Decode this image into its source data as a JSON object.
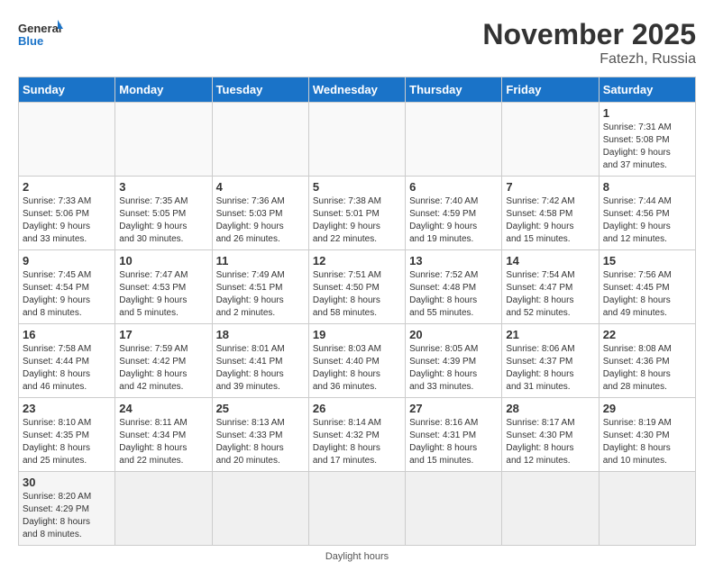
{
  "logo": {
    "general": "General",
    "blue": "Blue"
  },
  "title": "November 2025",
  "subtitle": "Fatezh, Russia",
  "days_of_week": [
    "Sunday",
    "Monday",
    "Tuesday",
    "Wednesday",
    "Thursday",
    "Friday",
    "Saturday"
  ],
  "footer": "Daylight hours",
  "weeks": [
    [
      {
        "day": "",
        "info": ""
      },
      {
        "day": "",
        "info": ""
      },
      {
        "day": "",
        "info": ""
      },
      {
        "day": "",
        "info": ""
      },
      {
        "day": "",
        "info": ""
      },
      {
        "day": "",
        "info": ""
      },
      {
        "day": "1",
        "info": "Sunrise: 7:31 AM\nSunset: 5:08 PM\nDaylight: 9 hours\nand 37 minutes."
      }
    ],
    [
      {
        "day": "2",
        "info": "Sunrise: 7:33 AM\nSunset: 5:06 PM\nDaylight: 9 hours\nand 33 minutes."
      },
      {
        "day": "3",
        "info": "Sunrise: 7:35 AM\nSunset: 5:05 PM\nDaylight: 9 hours\nand 30 minutes."
      },
      {
        "day": "4",
        "info": "Sunrise: 7:36 AM\nSunset: 5:03 PM\nDaylight: 9 hours\nand 26 minutes."
      },
      {
        "day": "5",
        "info": "Sunrise: 7:38 AM\nSunset: 5:01 PM\nDaylight: 9 hours\nand 22 minutes."
      },
      {
        "day": "6",
        "info": "Sunrise: 7:40 AM\nSunset: 4:59 PM\nDaylight: 9 hours\nand 19 minutes."
      },
      {
        "day": "7",
        "info": "Sunrise: 7:42 AM\nSunset: 4:58 PM\nDaylight: 9 hours\nand 15 minutes."
      },
      {
        "day": "8",
        "info": "Sunrise: 7:44 AM\nSunset: 4:56 PM\nDaylight: 9 hours\nand 12 minutes."
      }
    ],
    [
      {
        "day": "9",
        "info": "Sunrise: 7:45 AM\nSunset: 4:54 PM\nDaylight: 9 hours\nand 8 minutes."
      },
      {
        "day": "10",
        "info": "Sunrise: 7:47 AM\nSunset: 4:53 PM\nDaylight: 9 hours\nand 5 minutes."
      },
      {
        "day": "11",
        "info": "Sunrise: 7:49 AM\nSunset: 4:51 PM\nDaylight: 9 hours\nand 2 minutes."
      },
      {
        "day": "12",
        "info": "Sunrise: 7:51 AM\nSunset: 4:50 PM\nDaylight: 8 hours\nand 58 minutes."
      },
      {
        "day": "13",
        "info": "Sunrise: 7:52 AM\nSunset: 4:48 PM\nDaylight: 8 hours\nand 55 minutes."
      },
      {
        "day": "14",
        "info": "Sunrise: 7:54 AM\nSunset: 4:47 PM\nDaylight: 8 hours\nand 52 minutes."
      },
      {
        "day": "15",
        "info": "Sunrise: 7:56 AM\nSunset: 4:45 PM\nDaylight: 8 hours\nand 49 minutes."
      }
    ],
    [
      {
        "day": "16",
        "info": "Sunrise: 7:58 AM\nSunset: 4:44 PM\nDaylight: 8 hours\nand 46 minutes."
      },
      {
        "day": "17",
        "info": "Sunrise: 7:59 AM\nSunset: 4:42 PM\nDaylight: 8 hours\nand 42 minutes."
      },
      {
        "day": "18",
        "info": "Sunrise: 8:01 AM\nSunset: 4:41 PM\nDaylight: 8 hours\nand 39 minutes."
      },
      {
        "day": "19",
        "info": "Sunrise: 8:03 AM\nSunset: 4:40 PM\nDaylight: 8 hours\nand 36 minutes."
      },
      {
        "day": "20",
        "info": "Sunrise: 8:05 AM\nSunset: 4:39 PM\nDaylight: 8 hours\nand 33 minutes."
      },
      {
        "day": "21",
        "info": "Sunrise: 8:06 AM\nSunset: 4:37 PM\nDaylight: 8 hours\nand 31 minutes."
      },
      {
        "day": "22",
        "info": "Sunrise: 8:08 AM\nSunset: 4:36 PM\nDaylight: 8 hours\nand 28 minutes."
      }
    ],
    [
      {
        "day": "23",
        "info": "Sunrise: 8:10 AM\nSunset: 4:35 PM\nDaylight: 8 hours\nand 25 minutes."
      },
      {
        "day": "24",
        "info": "Sunrise: 8:11 AM\nSunset: 4:34 PM\nDaylight: 8 hours\nand 22 minutes."
      },
      {
        "day": "25",
        "info": "Sunrise: 8:13 AM\nSunset: 4:33 PM\nDaylight: 8 hours\nand 20 minutes."
      },
      {
        "day": "26",
        "info": "Sunrise: 8:14 AM\nSunset: 4:32 PM\nDaylight: 8 hours\nand 17 minutes."
      },
      {
        "day": "27",
        "info": "Sunrise: 8:16 AM\nSunset: 4:31 PM\nDaylight: 8 hours\nand 15 minutes."
      },
      {
        "day": "28",
        "info": "Sunrise: 8:17 AM\nSunset: 4:30 PM\nDaylight: 8 hours\nand 12 minutes."
      },
      {
        "day": "29",
        "info": "Sunrise: 8:19 AM\nSunset: 4:30 PM\nDaylight: 8 hours\nand 10 minutes."
      }
    ],
    [
      {
        "day": "30",
        "info": "Sunrise: 8:20 AM\nSunset: 4:29 PM\nDaylight: 8 hours\nand 8 minutes."
      },
      {
        "day": "",
        "info": ""
      },
      {
        "day": "",
        "info": ""
      },
      {
        "day": "",
        "info": ""
      },
      {
        "day": "",
        "info": ""
      },
      {
        "day": "",
        "info": ""
      },
      {
        "day": "",
        "info": ""
      }
    ]
  ]
}
